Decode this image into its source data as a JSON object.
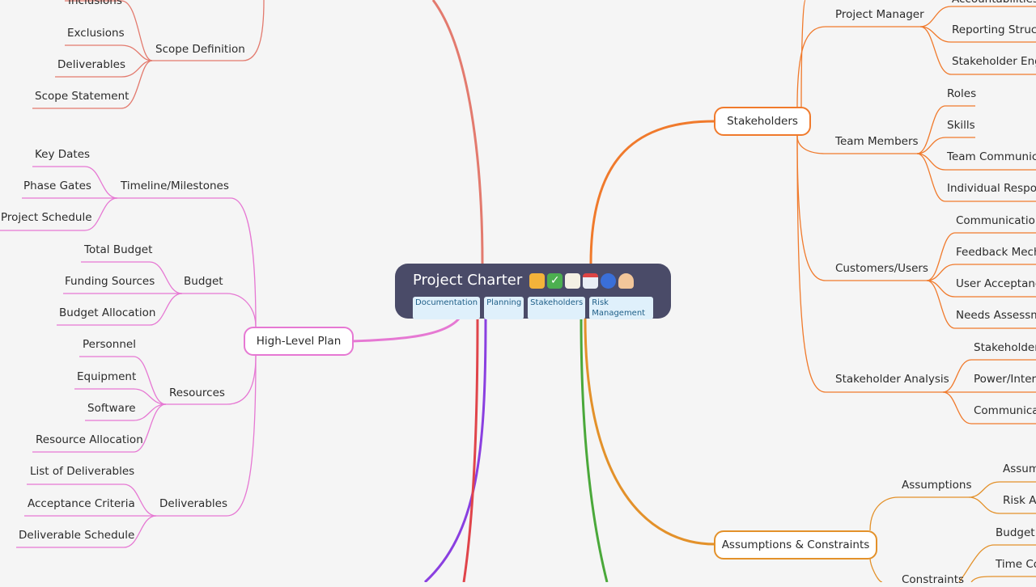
{
  "root": {
    "title": "Project Charter",
    "emojis": [
      "handshake-icon",
      "check-mark-icon",
      "memo-icon",
      "calendar-icon",
      "speaking-head-icon",
      "office-worker-icon"
    ],
    "tags": [
      "Documentation",
      "Planning",
      "Stakeholders",
      "Risk Management"
    ]
  },
  "left": {
    "scope_children": [
      "Inclusions",
      "Exclusions",
      "Deliverables",
      "Scope Statement"
    ],
    "scope_definition": "Scope Definition",
    "high_level_plan": "High-Level Plan",
    "timeline": {
      "label": "Timeline/Milestones",
      "children": [
        "Key Dates",
        "Phase Gates",
        "Project Schedule"
      ]
    },
    "budget": {
      "label": "Budget",
      "children": [
        "Total Budget",
        "Funding Sources",
        "Budget Allocation"
      ]
    },
    "resources": {
      "label": "Resources",
      "children": [
        "Personnel",
        "Equipment",
        "Software",
        "Resource Allocation"
      ]
    },
    "deliverables": {
      "label": "Deliverables",
      "children": [
        "List of Deliverables",
        "Acceptance Criteria",
        "Deliverable Schedule"
      ]
    }
  },
  "right": {
    "stakeholders": "Stakeholders",
    "project_manager": {
      "label": "Project Manager",
      "children": [
        "Accountabilities",
        "Reporting Structu",
        "Stakeholder Enga"
      ]
    },
    "team_members": {
      "label": "Team Members",
      "children": [
        "Roles",
        "Skills",
        "Team Communicat",
        "Individual Respons"
      ]
    },
    "customers": {
      "label": "Customers/Users",
      "children": [
        "Communication",
        "Feedback Mecha",
        "User Acceptance",
        "Needs Assessme"
      ]
    },
    "stakeholder_analysis": {
      "label": "Stakeholder Analysis",
      "children": [
        "Stakeholder I",
        "Power/Intere",
        "Communicat"
      ]
    },
    "assumptions_constraints": "Assumptions & Constraints",
    "assumptions": {
      "label": "Assumptions",
      "children": [
        "Assum",
        "Risk As"
      ]
    },
    "constraints": {
      "label": "Constraints",
      "children": [
        "Budget C",
        "Time Co"
      ]
    }
  },
  "colors": {
    "background": "#f5f5f5",
    "root": "#4a4b68",
    "scope": "#e37a6e",
    "plan": "#e678d3",
    "stakeholders": "#f07a2c",
    "assumptions": "#e3912a",
    "purple": "#8a3fe0",
    "red": "#e0444a",
    "green": "#4aa83a"
  }
}
